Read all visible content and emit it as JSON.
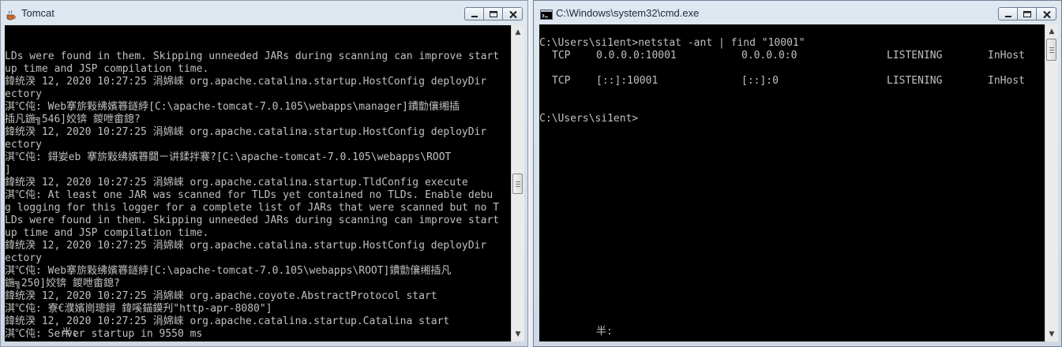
{
  "tomcat_window": {
    "title": "Tomcat",
    "icon": "java-cup-icon",
    "console_lines": [
      "LDs were found in them. Skipping unneeded JARs during scanning can improve start",
      "up time and JSP compilation time.",
      "鍏统湀 12, 2020 10:27:25 涓婂崍 org.apache.catalina.startup.HostConfig deployDir",
      "ectory",
      "淇℃伅: Web搴旂敤绋嬪簭鐩綍[C:\\apache-tomcat-7.0.105\\webapps\\manager]鐨勯儴缃插",
      "插凡鍦╗546]姣锛 鍐呭畬鎴?",
      "鍏统湀 12, 2020 10:27:25 涓婂崍 org.apache.catalina.startup.HostConfig deployDir",
      "ectory",
      "淇℃伅: 鎶妛eb 搴旂敤绋嬪簭閮ㄧ讲鍒拌褰?[C:\\apache-tomcat-7.0.105\\webapps\\ROOT",
      "]",
      "鍏统湀 12, 2020 10:27:25 涓婂崍 org.apache.catalina.startup.TldConfig execute",
      "淇℃伅: At least one JAR was scanned for TLDs yet contained no TLDs. Enable debu",
      "g logging for this logger for a complete list of JARs that were scanned but no T",
      "LDs were found in them. Skipping unneeded JARs during scanning can improve start",
      "up time and JSP compilation time.",
      "鍏统湀 12, 2020 10:27:25 涓婂崍 org.apache.catalina.startup.HostConfig deployDir",
      "ectory",
      "淇℃伅: Web搴旂敤绋嬪簭鐩綍[C:\\apache-tomcat-7.0.105\\webapps\\ROOT]鐨勯儴缃插凡",
      "鍦╗250]姣锛 鍐呭畬鎴?",
      "鍏统湀 12, 2020 10:27:25 涓婂崍 org.apache.coyote.AbstractProtocol start",
      "淇℃伅: 寮€濮嬪崗璁鐞 鍏嗘錨鏌刋\"http-apr-8080\"]",
      "鍏统湀 12, 2020 10:27:25 涓婂崍 org.apache.catalina.startup.Catalina start",
      "淇℃伅: Server startup in 9550 ms"
    ],
    "ime_indicator": "半:"
  },
  "cmd_window": {
    "title": "C:\\Windows\\system32\\cmd.exe",
    "icon": "cmd-icon",
    "command_line": "C:\\Users\\si1ent>netstat -ant | find \"10001\"",
    "rows": [
      {
        "proto": "TCP",
        "local": "0.0.0.0:10001",
        "foreign": "0.0.0.0:0",
        "state": "LISTENING",
        "offload": "InHost"
      },
      {
        "proto": "TCP",
        "local": "[::]:10001",
        "foreign": "[::]:0",
        "state": "LISTENING",
        "offload": "InHost"
      }
    ],
    "prompt": "C:\\Users\\si1ent>",
    "ime_indicator": "半:"
  },
  "scrollbar": {
    "up_glyph": "▲",
    "down_glyph": "▼"
  }
}
